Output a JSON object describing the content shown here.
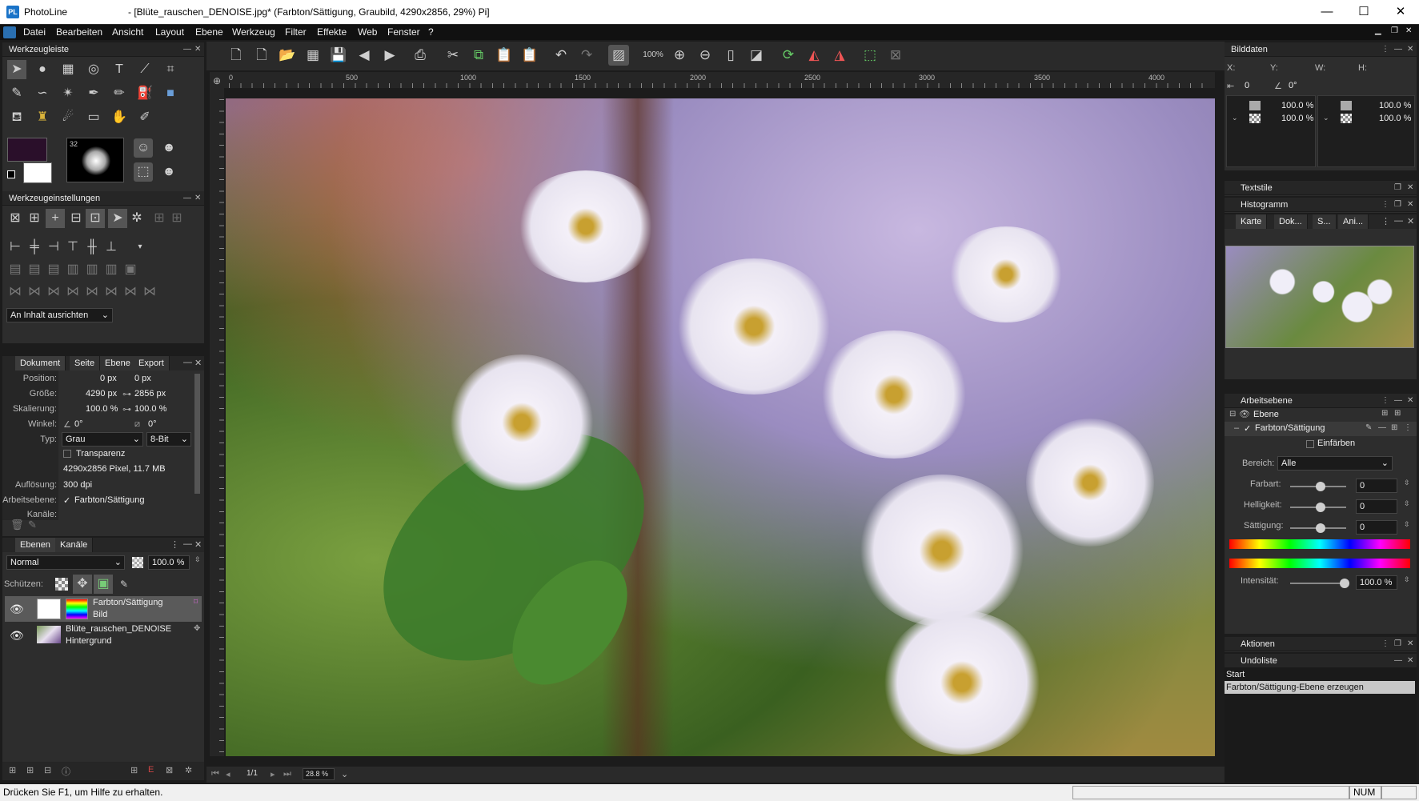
{
  "app": {
    "name": "PhotoLine",
    "document_title": "- [Blüte_rauschen_DENOISE.jpg* (Farbton/Sättigung, Graubild, 4290x2856, 29%) Pi]"
  },
  "window": {
    "minimize": "—",
    "maximize": "☐",
    "close": "✕"
  },
  "menu": [
    "Datei",
    "Bearbeiten",
    "Ansicht",
    "Layout",
    "Ebene",
    "Werkzeug",
    "Filter",
    "Effekte",
    "Web",
    "Fenster",
    "?"
  ],
  "toolbar": {
    "zoom_label": "100%"
  },
  "ruler": {
    "ticks": [
      "0",
      "500",
      "1000",
      "1500",
      "2000",
      "2500",
      "3000",
      "3500",
      "4000"
    ]
  },
  "panels": {
    "werkzeugleiste": {
      "title": "Werkzeugleiste",
      "brush_size": "32"
    },
    "werkzeugeinstellungen": {
      "title": "Werkzeugeinstellungen",
      "align_select": "An Inhalt ausrichten"
    },
    "dokument": {
      "tabs": [
        "Dokument",
        "Seite",
        "Ebene",
        "Export"
      ],
      "rows": [
        {
          "label": "Position:",
          "v1": "0 px",
          "v2": "0 px"
        },
        {
          "label": "Größe:",
          "v1": "4290 px",
          "v2": "2856 px"
        },
        {
          "label": "Skalierung:",
          "v1": "100.0 %",
          "v2": "100.0 %"
        },
        {
          "label": "Winkel:",
          "v1": "0°",
          "v2": "0°"
        }
      ],
      "typ_label": "Typ:",
      "typ_value": "Grau",
      "bit_value": "8-Bit",
      "transparenz": "Transparenz",
      "info": "4290x2856 Pixel, 11.7 MB",
      "aufloesung_label": "Auflösung:",
      "aufloesung": "300 dpi",
      "arbeitsebene_label": "Arbeitsebene:",
      "arbeitsebene": "Farbton/Sättigung",
      "kanaele_label": "Kanäle:"
    },
    "ebenen": {
      "tabs": [
        "Ebenen",
        "Kanäle"
      ],
      "blend_mode": "Normal",
      "opacity": "100.0 %",
      "schuetzen": "Schützen:",
      "layers": [
        {
          "name": "Farbton/Sättigung",
          "sub": "Bild"
        },
        {
          "name": "Blüte_rauschen_DENOISE",
          "sub": "Hintergrund"
        }
      ]
    },
    "bilddaten": {
      "title": "Bilddaten",
      "x": "X:",
      "y": "Y:",
      "w": "W:",
      "h": "H:",
      "offset": "0",
      "angle": "0°",
      "p1": "100.0 %",
      "p2": "100.0 %",
      "p3": "100.0 %",
      "p4": "100.0 %"
    },
    "textstile": {
      "title": "Textstile"
    },
    "histogramm": {
      "title": "Histogramm",
      "tabs": [
        "Karte",
        "Dok...",
        "S...",
        "Ani..."
      ]
    },
    "arbeitsebene": {
      "title": "Arbeitsebene",
      "tree_root": "Ebene",
      "tree_item": "Farbton/Sättigung",
      "einfaerben": "Einfärben",
      "bereich_label": "Bereich:",
      "bereich": "Alle",
      "farbart_label": "Farbart:",
      "farbart": "0",
      "helligkeit_label": "Helligkeit:",
      "helligkeit": "0",
      "saettigung_label": "Sättigung:",
      "saettigung": "0",
      "intensitaet_label": "Intensität:",
      "intensitaet": "100.0 %"
    },
    "aktionen": {
      "title": "Aktionen"
    },
    "undoliste": {
      "title": "Undoliste",
      "items": [
        "Start",
        "Farbton/Sättigung-Ebene erzeugen"
      ]
    }
  },
  "nav": {
    "page": "1/1",
    "zoom": "28.8 %"
  },
  "status": {
    "text": "Drücken Sie F1, um Hilfe zu erhalten.",
    "num": "NUM"
  }
}
